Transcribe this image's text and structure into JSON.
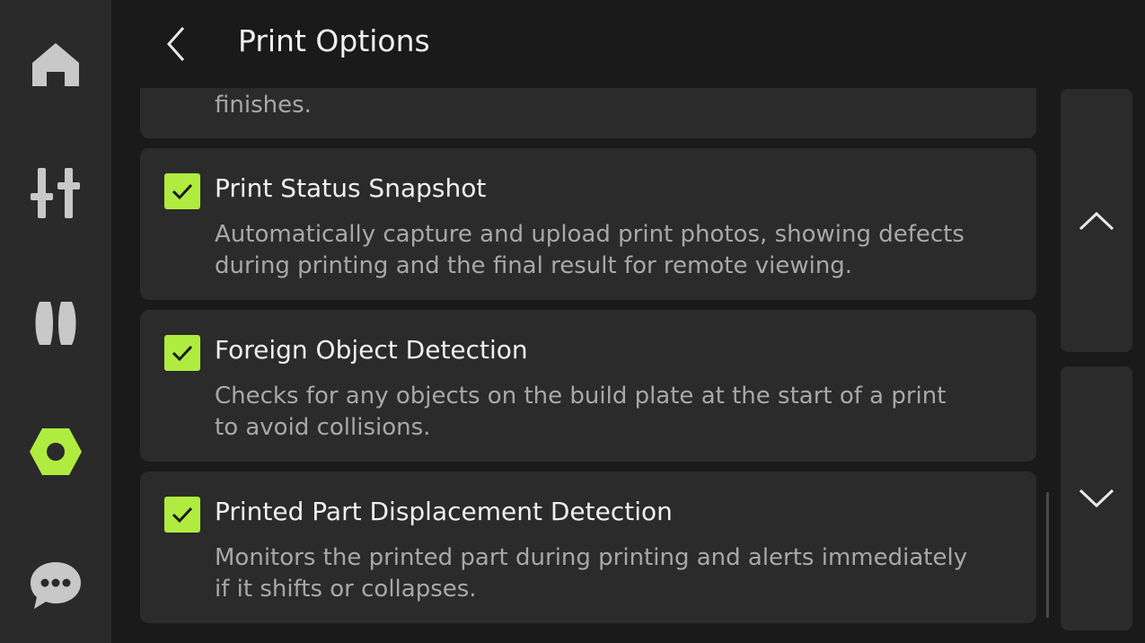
{
  "app": {
    "accent_color": "#b0ec3f",
    "background_color": "#1a1a1a",
    "card_color": "#2b2b2b"
  },
  "sidebar": {
    "items": [
      {
        "icon": "home-icon",
        "active": false
      },
      {
        "icon": "sliders-icon",
        "active": false
      },
      {
        "icon": "filament-icon",
        "active": false
      },
      {
        "icon": "settings-hex-icon",
        "active": true
      },
      {
        "icon": "chat-icon",
        "active": false
      }
    ]
  },
  "header": {
    "back_icon": "chevron-left-icon",
    "title": "Print Options"
  },
  "options": {
    "partial_desc": "finishes.",
    "items": [
      {
        "checked": true,
        "title": "Print Status Snapshot",
        "desc_line1": "Automatically capture and upload print photos, showing defects",
        "desc_line2": "during printing and the final result for remote viewing."
      },
      {
        "checked": true,
        "title": "Foreign Object Detection",
        "desc_line1": "Checks for any objects on the build plate at the start of a print",
        "desc_line2": "to avoid collisions."
      },
      {
        "checked": true,
        "title": "Printed Part Displacement Detection",
        "desc_line1": "Monitors the printed part during printing and alerts immediately",
        "desc_line2": "if it shifts or collapses."
      }
    ]
  },
  "pager": {
    "up_icon": "chevron-up-icon",
    "down_icon": "chevron-down-icon"
  }
}
